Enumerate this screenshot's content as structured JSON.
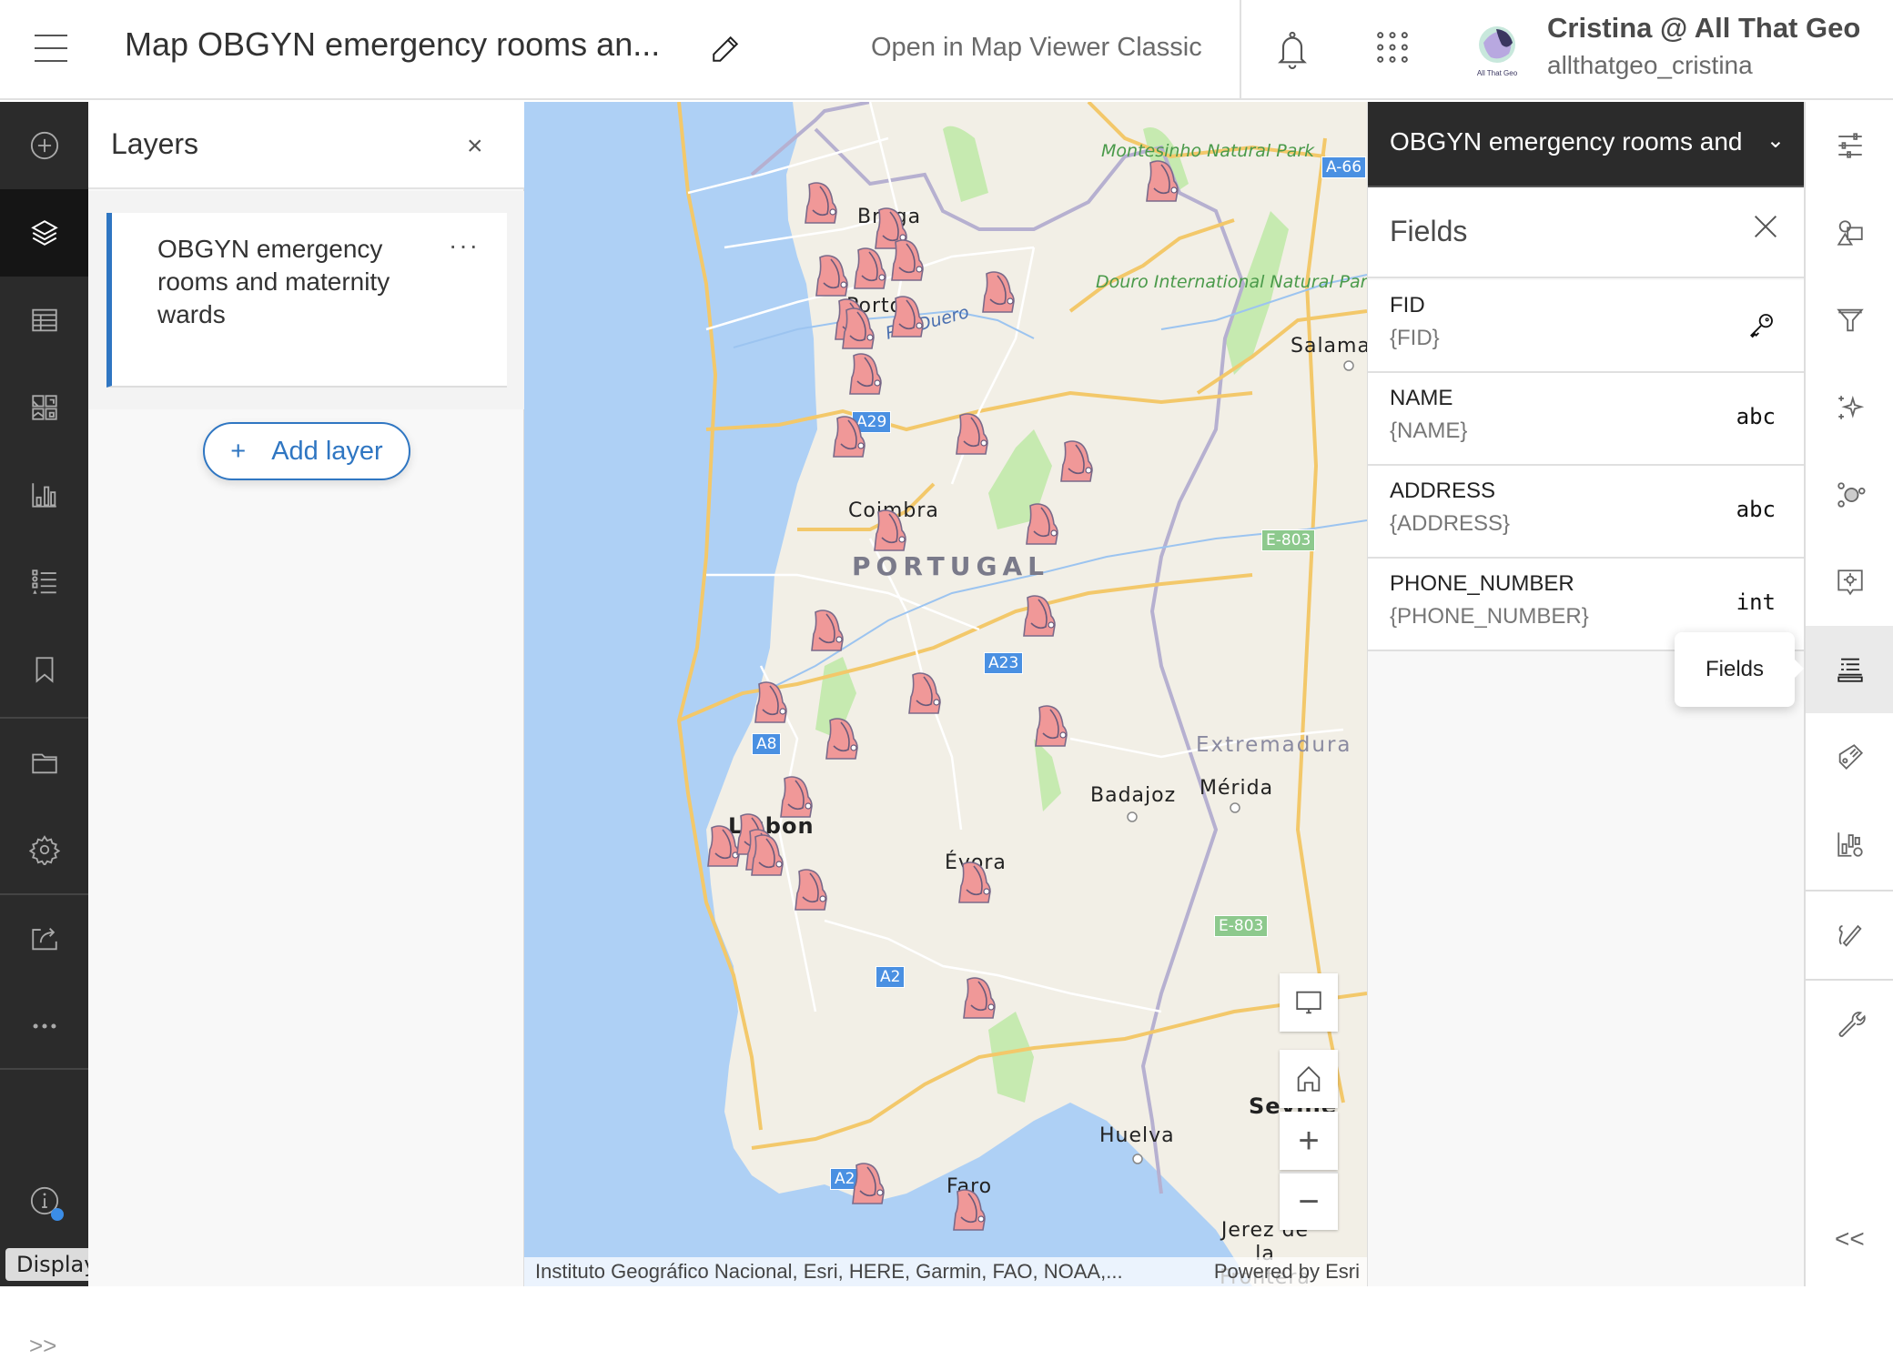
{
  "header": {
    "menu_icon": "hamburger-icon",
    "title": "Map OBGYN emergency rooms an...",
    "edit_icon": "pencil-icon",
    "open_classic": "Open in Map Viewer Classic",
    "notifications_icon": "bell-icon",
    "apps_icon": "app-launcher-icon",
    "user": {
      "avatar_label": "All That Geo",
      "display_name": "Cristina @ All That Geo",
      "username": "allthatgeo_cristina"
    }
  },
  "left_toolbar": {
    "items": [
      {
        "name": "add",
        "icon": "plus-circle-icon",
        "active": false
      },
      {
        "name": "layers",
        "icon": "layers-icon",
        "active": true
      },
      {
        "name": "tables",
        "icon": "table-icon",
        "active": false
      },
      {
        "name": "basemap",
        "icon": "basemap-icon",
        "active": false
      },
      {
        "name": "charts",
        "icon": "bar-chart-icon",
        "active": false
      },
      {
        "name": "legend",
        "icon": "legend-icon",
        "active": false
      },
      {
        "name": "bookmarks",
        "icon": "bookmark-icon",
        "active": false
      },
      {
        "name": "map-properties",
        "icon": "folder-icon",
        "active": false
      },
      {
        "name": "settings",
        "icon": "gear-icon",
        "active": false
      },
      {
        "name": "share",
        "icon": "share-icon",
        "active": false
      },
      {
        "name": "more",
        "icon": "more-icon",
        "active": false
      },
      {
        "name": "info",
        "icon": "info-icon",
        "active": false
      }
    ],
    "expand_icon": ">>",
    "tooltip": "Display a menu"
  },
  "layers_panel": {
    "title": "Layers",
    "close_icon": "×",
    "layers": [
      {
        "name": "OBGYN emergency rooms and maternity wards",
        "menu": "···"
      }
    ],
    "add_layer_icon": "+",
    "add_layer_label": "Add layer"
  },
  "map": {
    "labels": {
      "braga": "Braga",
      "porto": "Porto",
      "coimbra": "Coimbra",
      "portugal": "PORTUGAL",
      "lisbon": "Lisbon",
      "evora": "Évora",
      "faro": "Faro",
      "salamanca": "Salama",
      "badajoz": "Badajoz",
      "merida": "Mérida",
      "extremadura": "Extremadura",
      "seville": "Seville",
      "huelva": "Huelva",
      "jerez": "Jerez de la Frontera",
      "montesinho": "Montesinho Natural Park",
      "douro": "Douro International Natural Park",
      "rio_duero": "Río Duero"
    },
    "shields": {
      "a66": "A-66",
      "a29": "A29",
      "a23": "A23",
      "a8": "A8",
      "a2": "A2",
      "a22": "A2",
      "e803a": "E-803",
      "e803b": "E-803"
    },
    "marker_color": "#f09898",
    "marker_count": 32,
    "controls": {
      "fullscreen_icon": "monitor-icon",
      "home_icon": "home-icon",
      "zoom_in": "+",
      "zoom_out": "−"
    },
    "attribution": "Instituto Geográfico Nacional, Esri, HERE, Garmin, FAO, NOAA,...",
    "powered_by": "Powered by Esri"
  },
  "right_panel": {
    "layer_select": "OBGYN emergency rooms and",
    "fields_title": "Fields",
    "fields": [
      {
        "name": "FID",
        "expression": "{FID}",
        "type": "key"
      },
      {
        "name": "NAME",
        "expression": "{NAME}",
        "type": "abc"
      },
      {
        "name": "ADDRESS",
        "expression": "{ADDRESS}",
        "type": "abc"
      },
      {
        "name": "PHONE_NUMBER",
        "expression": "{PHONE_NUMBER}",
        "type": "int"
      }
    ]
  },
  "right_toolbar": {
    "items": [
      {
        "name": "properties",
        "icon": "sliders-icon"
      },
      {
        "name": "styles",
        "icon": "shapes-icon"
      },
      {
        "name": "filter",
        "icon": "filter-icon"
      },
      {
        "name": "effects",
        "icon": "sparkle-icon"
      },
      {
        "name": "clustering",
        "icon": "cluster-icon"
      },
      {
        "name": "configure-popups",
        "icon": "popup-config-icon"
      },
      {
        "name": "fields",
        "icon": "fields-icon",
        "active": true
      },
      {
        "name": "labels",
        "icon": "label-icon"
      },
      {
        "name": "configure-charts",
        "icon": "chart-config-icon"
      },
      {
        "name": "sketch",
        "icon": "sketch-icon"
      },
      {
        "name": "tools",
        "icon": "wrench-icon"
      }
    ],
    "tooltip": "Fields",
    "collapse_icon": "<<"
  }
}
